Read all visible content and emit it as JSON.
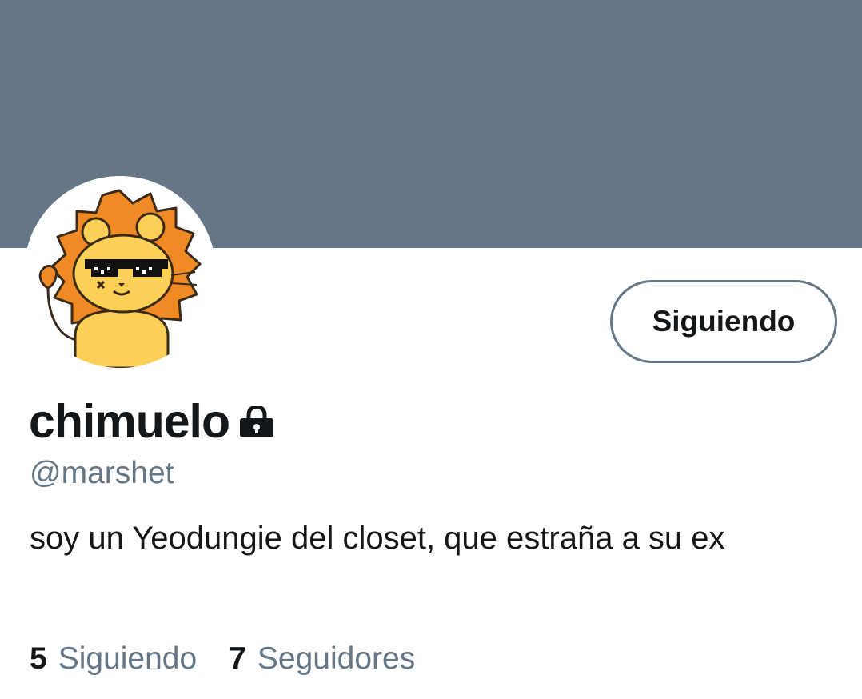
{
  "profile": {
    "display_name": "chimuelo",
    "handle": "@marshet",
    "bio": "soy un Yeodungie del closet, que estraña a su ex",
    "avatar_icon": "lion-with-sunglasses-avatar",
    "protected_icon": "lock-icon"
  },
  "actions": {
    "follow_label": "Siguiendo"
  },
  "stats": {
    "following_count": "5",
    "following_label": "Siguiendo",
    "followers_count": "7",
    "followers_label": "Seguidores"
  },
  "colors": {
    "banner": "#657786",
    "text_primary": "#14171a",
    "text_secondary": "#657786",
    "avatar_mane": "#f08a24",
    "avatar_face": "#fcd056"
  }
}
